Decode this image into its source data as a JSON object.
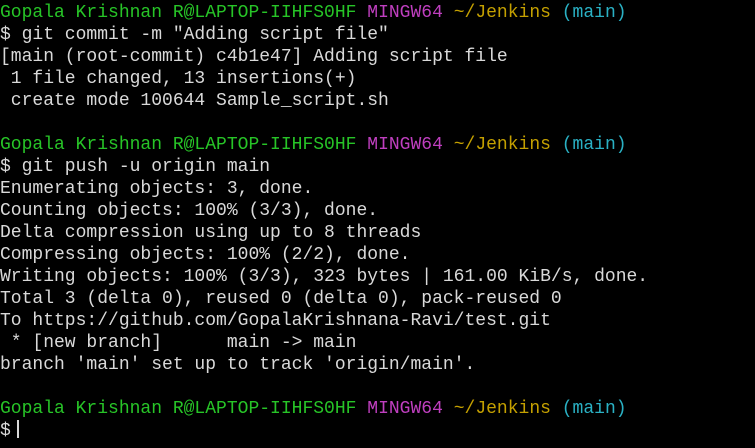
{
  "prompt1": {
    "user": "Gopala Krishnan R@LAPTOP-IIHFS0HF",
    "shell": "MINGW64",
    "path": "~/Jenkins",
    "branch": "(main)",
    "command": "$ git commit -m \"Adding script file\""
  },
  "commit_output": [
    "[main (root-commit) c4b1e47] Adding script file",
    " 1 file changed, 13 insertions(+)",
    " create mode 100644 Sample_script.sh"
  ],
  "prompt2": {
    "user": "Gopala Krishnan R@LAPTOP-IIHFS0HF",
    "shell": "MINGW64",
    "path": "~/Jenkins",
    "branch": "(main)",
    "command": "$ git push -u origin main"
  },
  "push_output": [
    "Enumerating objects: 3, done.",
    "Counting objects: 100% (3/3), done.",
    "Delta compression using up to 8 threads",
    "Compressing objects: 100% (2/2), done.",
    "Writing objects: 100% (3/3), 323 bytes | 161.00 KiB/s, done.",
    "Total 3 (delta 0), reused 0 (delta 0), pack-reused 0",
    "To https://github.com/GopalaKrishnana-Ravi/test.git",
    " * [new branch]      main -> main",
    "branch 'main' set up to track 'origin/main'."
  ],
  "prompt3": {
    "user": "Gopala Krishnan R@LAPTOP-IIHFS0HF",
    "shell": "MINGW64",
    "path": "~/Jenkins",
    "branch": "(main)",
    "command": "$"
  },
  "colors": {
    "background": "#000000",
    "text": "#d9d9d9",
    "user": "#27c427",
    "shell": "#bf3fbf",
    "path": "#c4a000",
    "branch": "#2ab1c4"
  }
}
